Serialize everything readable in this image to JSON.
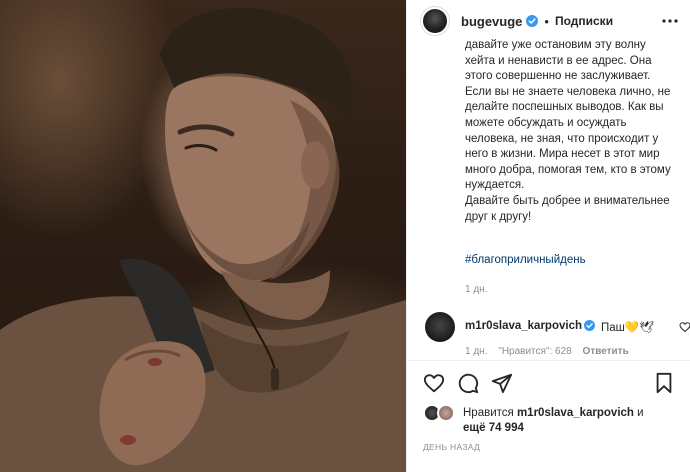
{
  "post": {
    "author": "bugevuge",
    "separator": "•",
    "follow_label": "Подписки",
    "caption_lines": [
      "давайте уже остановим эту волну",
      "хейта и ненависти в ее адрес. Она",
      "этого совершенно не заслуживает.",
      "Если вы не знаете человека лично, не",
      "делайте поспешных выводов. Как вы",
      "можете обсуждать и осуждать",
      "человека, не зная, что происходит у",
      "него в жизни. Мира несет в этот мир",
      "много добра, помогая тем, кто в этому",
      "нуждается.",
      "Давайте быть добрее и внимательнее",
      "друг к другу!"
    ],
    "hashtag": "#благоприличныйдень",
    "time": "1 дн."
  },
  "comment": {
    "user": "m1r0slava_karpovich",
    "text": "Паш💛🕊",
    "time": "1 дн.",
    "likes": "\"Нравится\": 628",
    "reply_label": "Ответить"
  },
  "actions": {
    "icons": [
      "heart-icon",
      "comment-icon",
      "share-icon",
      "bookmark-icon"
    ]
  },
  "likes": {
    "prefix": "Нравится",
    "user": "m1r0slava_karpovich",
    "conj": "и",
    "others": "ещё 74 994"
  },
  "date": "ДЕНЬ НАЗАД",
  "colors": {
    "verified": "#3897f0",
    "hashtag": "#00376b",
    "muted": "#8e8e8e"
  }
}
